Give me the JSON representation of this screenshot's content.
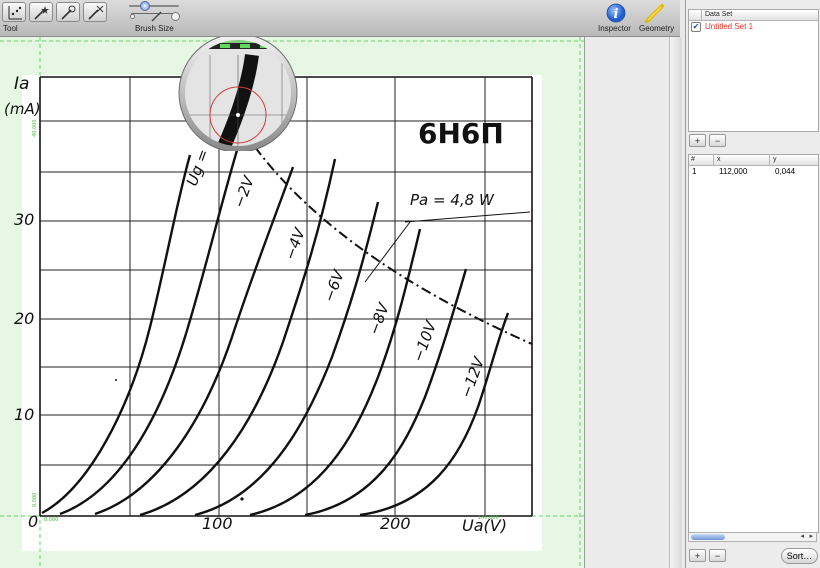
{
  "toolbar": {
    "tool_label": "Tool",
    "brush_size_label": "Brush Size",
    "inspector_label": "Inspector",
    "geometry_label": "Geometry"
  },
  "graph": {
    "tube_name": "6Н6П",
    "y_axis_label": "Ia",
    "y_axis_unit": "(mA)",
    "x_axis_label": "Ua(V)",
    "y_ticks": [
      "10",
      "20",
      "30"
    ],
    "x_ticks": [
      "0",
      "100",
      "200"
    ],
    "grid_labels": [
      "0,000",
      "40,000",
      "140,000",
      "0,000"
    ],
    "pa_label": "Pa = 4,8 W",
    "curve_labels": [
      "Ug =",
      "−2V",
      "−4V",
      "−6V",
      "−8V",
      "−10V",
      "−12V"
    ]
  },
  "data_sets": {
    "header": "Data Set",
    "items": [
      {
        "name": "Untitled Set 1",
        "checked": true,
        "color": "#e03a2e"
      }
    ]
  },
  "points": {
    "columns": [
      "#",
      "x",
      "y"
    ],
    "rows": [
      {
        "index": "1",
        "x": "112,000",
        "y": "0,044"
      }
    ]
  },
  "buttons": {
    "add": "+",
    "remove": "−",
    "sort": "Sort…"
  },
  "colors": {
    "canvas_bg": "#e6f8e3",
    "accent_red": "#e03a2e",
    "guide_green": "#5fd85f"
  }
}
